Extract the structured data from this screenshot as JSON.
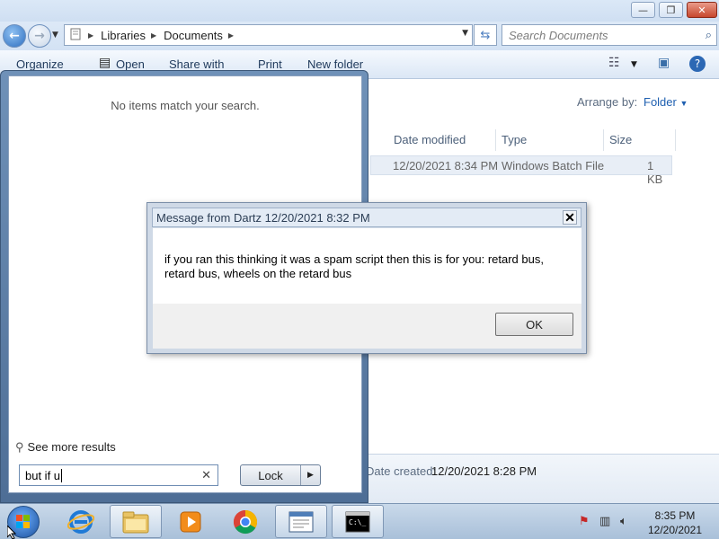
{
  "window": {
    "buttons": {
      "minimize": "—",
      "maximize": "❐",
      "close": "✕"
    }
  },
  "address": {
    "crumbs": [
      "Libraries",
      "Documents"
    ],
    "search_placeholder": "Search Documents"
  },
  "toolbar": {
    "organize": "Organize",
    "open": "Open",
    "share_with": "Share with",
    "print": "Print",
    "new_folder": "New folder"
  },
  "arrange": {
    "label": "Arrange by:",
    "value": "Folder"
  },
  "columns": {
    "date_modified": "Date modified",
    "type": "Type",
    "size": "Size"
  },
  "file": {
    "date_modified": "12/20/2021 8:34 PM",
    "type": "Windows Batch File",
    "size": "1 KB"
  },
  "details": {
    "date_created_label": "Date created:",
    "date_created_value": "12/20/2021 8:28 PM"
  },
  "start_menu": {
    "no_items": "No items match your search.",
    "see_more": "See more results",
    "search_value": "but if u",
    "lock_label": "Lock"
  },
  "message": {
    "title": "Message from Dartz 12/20/2021 8:32 PM",
    "body": "if you ran this thinking it was a spam script then this is for you: retard bus, retard bus, wheels on the retard bus",
    "ok": "OK"
  },
  "taskbar": {
    "time": "8:35 PM",
    "date": "12/20/2021",
    "apps": [
      "internet-explorer",
      "file-explorer",
      "media-player",
      "chrome",
      "window",
      "command-prompt"
    ]
  },
  "colors": {
    "accent": "#1e6fc0",
    "titlebar": "#dbe8f7",
    "taskbar": "#b9cde2"
  }
}
